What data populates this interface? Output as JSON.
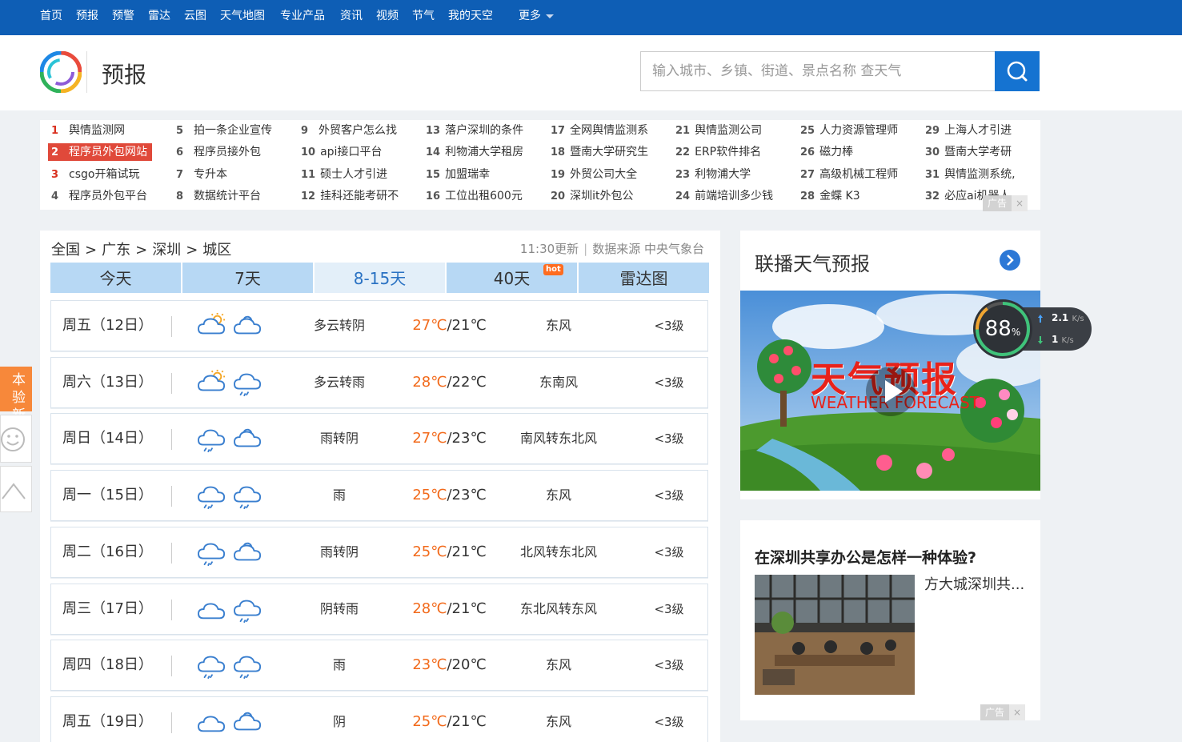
{
  "nav": {
    "items": [
      "首页",
      "预报",
      "预警",
      "雷达",
      "云图",
      "天气地图",
      "专业产品",
      "资讯",
      "视频",
      "节气",
      "我的天空"
    ],
    "more": "更多"
  },
  "header": {
    "title": "预报",
    "search_placeholder": "输入城市、乡镇、街道、景点名称 查天气"
  },
  "hotlinks": [
    {
      "n": "1",
      "text": "舆情监测网"
    },
    {
      "n": "2",
      "text": "程序员外包网站"
    },
    {
      "n": "3",
      "text": "csgo开箱试玩"
    },
    {
      "n": "4",
      "text": "程序员外包平台"
    },
    {
      "n": "5",
      "text": "拍一条企业宣传"
    },
    {
      "n": "6",
      "text": "程序员接外包"
    },
    {
      "n": "7",
      "text": "专升本"
    },
    {
      "n": "8",
      "text": "数据统计平台"
    },
    {
      "n": "9",
      "text": "外贸客户怎么找"
    },
    {
      "n": "10",
      "text": "api接口平台"
    },
    {
      "n": "11",
      "text": "硕士人才引进"
    },
    {
      "n": "12",
      "text": "挂科还能考研不"
    },
    {
      "n": "13",
      "text": "落户深圳的条件"
    },
    {
      "n": "14",
      "text": "利物浦大学租房"
    },
    {
      "n": "15",
      "text": "加盟瑞幸"
    },
    {
      "n": "16",
      "text": "工位出租600元"
    },
    {
      "n": "17",
      "text": "全网舆情监测系"
    },
    {
      "n": "18",
      "text": "暨南大学研究生"
    },
    {
      "n": "19",
      "text": "外贸公司大全"
    },
    {
      "n": "20",
      "text": "深圳it外包公"
    },
    {
      "n": "21",
      "text": "舆情监测公司"
    },
    {
      "n": "22",
      "text": "ERP软件排名"
    },
    {
      "n": "23",
      "text": "利物浦大学"
    },
    {
      "n": "24",
      "text": "前端培训多少钱"
    },
    {
      "n": "25",
      "text": "人力资源管理师"
    },
    {
      "n": "26",
      "text": "磁力棒"
    },
    {
      "n": "27",
      "text": "高级机械工程师"
    },
    {
      "n": "28",
      "text": "金蝶 K3"
    },
    {
      "n": "29",
      "text": "上海人才引进"
    },
    {
      "n": "30",
      "text": "暨南大学考研"
    },
    {
      "n": "31",
      "text": "舆情监测系统,"
    },
    {
      "n": "32",
      "text": "必应ai机器人"
    }
  ],
  "ad_label": "广告",
  "ad_close": "×",
  "breadcrumb": {
    "a": "全国",
    "b": "广东",
    "c": "深圳",
    "d": "城区",
    "sep": ">"
  },
  "update": {
    "time": "11:30更新",
    "source": "数据来源 中央气象台",
    "bar": "|"
  },
  "tabs": [
    "今天",
    "7天",
    "8-15天",
    "40天",
    "雷达图"
  ],
  "hot_badge": "hot",
  "forecast": [
    {
      "day": "周五（12日）",
      "icon1": "partly-cloudy-day-icon",
      "icon2": "cloudy-icon",
      "cond": "多云转阴",
      "hi": "27℃",
      "lo": "/21℃",
      "wind": "东风",
      "level": "<3级"
    },
    {
      "day": "周六（13日）",
      "icon1": "partly-cloudy-day-icon",
      "icon2": "rain-icon",
      "cond": "多云转雨",
      "hi": "28℃",
      "lo": "/22℃",
      "wind": "东南风",
      "level": "<3级"
    },
    {
      "day": "周日（14日）",
      "icon1": "rain-icon",
      "icon2": "cloudy-icon",
      "cond": "雨转阴",
      "hi": "27℃",
      "lo": "/23℃",
      "wind": "南风转东北风",
      "level": "<3级"
    },
    {
      "day": "周一（15日）",
      "icon1": "rain-icon",
      "icon2": "rain-icon",
      "cond": "雨",
      "hi": "25℃",
      "lo": "/23℃",
      "wind": "东风",
      "level": "<3级"
    },
    {
      "day": "周二（16日）",
      "icon1": "rain-icon",
      "icon2": "cloudy-icon",
      "cond": "雨转阴",
      "hi": "25℃",
      "lo": "/21℃",
      "wind": "北风转东北风",
      "level": "<3级"
    },
    {
      "day": "周三（17日）",
      "icon1": "overcast-icon",
      "icon2": "rain-icon",
      "cond": "阴转雨",
      "hi": "28℃",
      "lo": "/21℃",
      "wind": "东北风转东风",
      "level": "<3级"
    },
    {
      "day": "周四（18日）",
      "icon1": "rain-icon",
      "icon2": "rain-icon",
      "cond": "雨",
      "hi": "23℃",
      "lo": "/20℃",
      "wind": "东风",
      "level": "<3级"
    },
    {
      "day": "周五（19日）",
      "icon1": "overcast-icon",
      "icon2": "cloudy-icon",
      "cond": "阴",
      "hi": "25℃",
      "lo": "/21℃",
      "wind": "东风",
      "level": "<3级"
    }
  ],
  "side": {
    "new_line1": "本验",
    "new_line2": "新版"
  },
  "video": {
    "title": "联播天气预报",
    "logo_text": "天气预报",
    "logo_sub": "WEATHER FORECAST"
  },
  "net": {
    "pct": "88",
    "pct_unit": "%",
    "up": "2.1",
    "up_unit": "K/s",
    "down": "1",
    "down_unit": "K/s"
  },
  "ad2": {
    "title": "在深圳共享办公是怎样一种体验?",
    "text": "方大城深圳共..."
  },
  "colors": {
    "nav": "#0e5eb5",
    "accent": "#1573d1",
    "temp_high": "#f26a1b",
    "tab": "#b7d8f4"
  }
}
